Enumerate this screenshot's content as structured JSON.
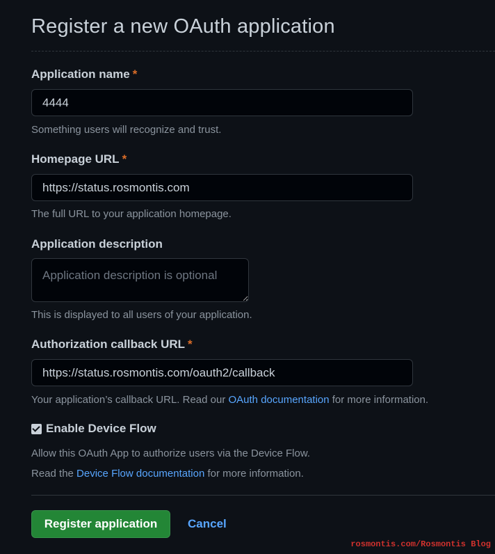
{
  "page": {
    "title": "Register a new OAuth application"
  },
  "fields": {
    "app_name": {
      "label": "Application name",
      "required_mark": "*",
      "value": "4444",
      "note": "Something users will recognize and trust."
    },
    "homepage_url": {
      "label": "Homepage URL",
      "required_mark": "*",
      "value": "https://status.rosmontis.com",
      "note": "The full URL to your application homepage."
    },
    "description": {
      "label": "Application description",
      "placeholder": "Application description is optional",
      "value": "",
      "note": "This is displayed to all users of your application."
    },
    "callback_url": {
      "label": "Authorization callback URL",
      "required_mark": "*",
      "value": "https://status.rosmontis.com/oauth2/callback",
      "note_before": "Your application’s callback URL. Read our ",
      "note_link": "OAuth documentation",
      "note_after": " for more information."
    }
  },
  "device_flow": {
    "label": "Enable Device Flow",
    "checked": true,
    "note_line1": "Allow this OAuth App to authorize users via the Device Flow.",
    "note_line2_before": "Read the ",
    "note_line2_link": "Device Flow documentation",
    "note_line2_after": " for more information."
  },
  "actions": {
    "register_label": "Register application",
    "cancel_label": "Cancel"
  },
  "watermark": {
    "text": "rosmontis.com/Rosmontis Blog"
  },
  "colors": {
    "background": "#0d1117",
    "input_background": "#010409",
    "primary_button": "#238636",
    "link": "#58a6ff",
    "required_mark": "#db6d28"
  }
}
